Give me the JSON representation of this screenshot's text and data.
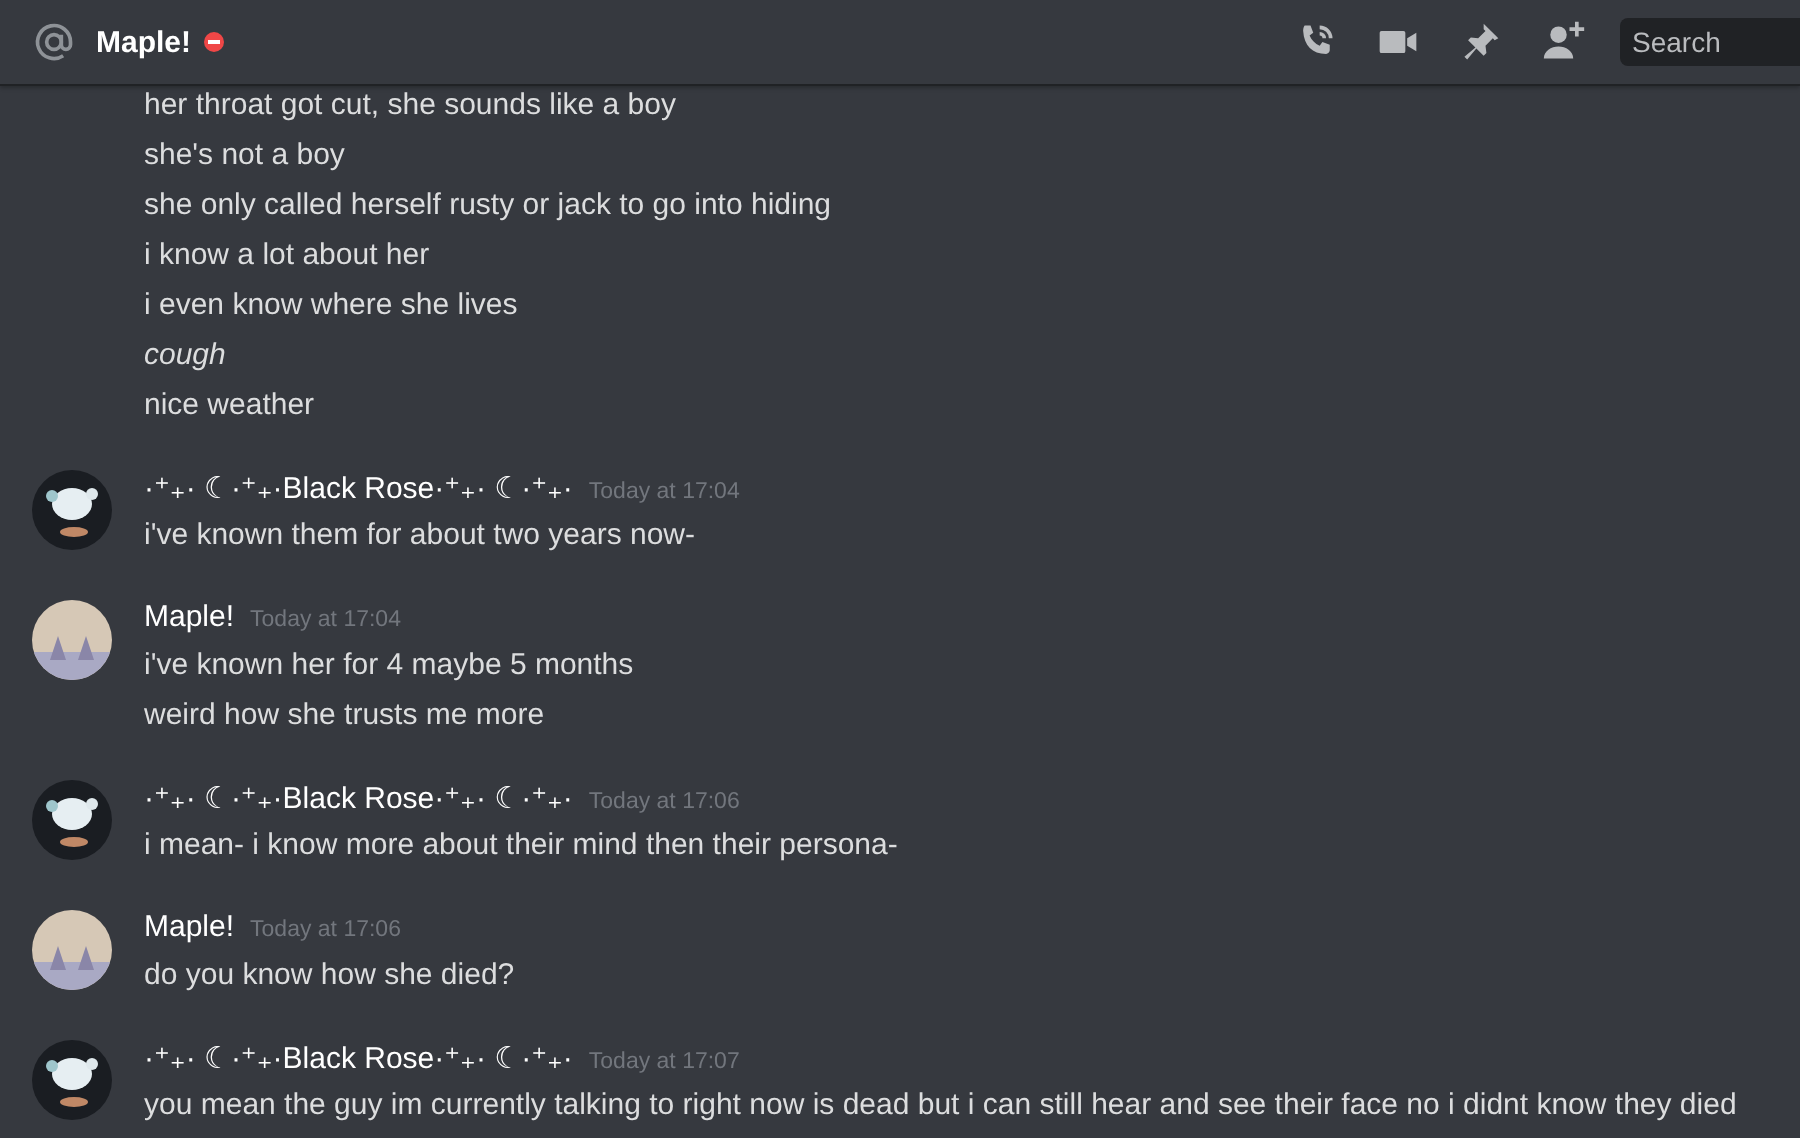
{
  "header": {
    "title": "Maple!",
    "status": {
      "kind": "dnd"
    },
    "search": {
      "placeholder": "Search"
    }
  },
  "messages": [
    {
      "lines": [
        {
          "text": "her throat got cut, she sounds like a boy",
          "italic": false
        },
        {
          "text": "she's not a boy",
          "italic": false
        },
        {
          "text": "she only called herself rusty or jack to go into hiding",
          "italic": false
        },
        {
          "text": "i know a lot about her",
          "italic": false
        },
        {
          "text": "i even know where she lives",
          "italic": false
        },
        {
          "text": "cough",
          "italic": true
        },
        {
          "text": "nice weather",
          "italic": false
        }
      ]
    },
    {
      "author": "·⁺₊· ☾·⁺₊·Black Rose·⁺₊· ☾·⁺₊·",
      "time": "Today at 17:04",
      "kind": "dark",
      "lines": [
        {
          "text": "i've known them for about two years now-",
          "italic": false
        }
      ]
    },
    {
      "author": "Maple!",
      "time": "Today at 17:04",
      "kind": "light",
      "lines": [
        {
          "text": "i've known her for 4 maybe 5 months",
          "italic": false
        },
        {
          "text": "weird how she trusts me more",
          "italic": false
        }
      ]
    },
    {
      "author": "·⁺₊· ☾·⁺₊·Black Rose·⁺₊· ☾·⁺₊·",
      "time": "Today at 17:06",
      "kind": "dark",
      "lines": [
        {
          "text": "i mean- i know more about their mind then their persona-",
          "italic": false
        }
      ]
    },
    {
      "author": "Maple!",
      "time": "Today at 17:06",
      "kind": "light",
      "lines": [
        {
          "text": "do you know how she died?",
          "italic": false
        }
      ]
    },
    {
      "author": "·⁺₊· ☾·⁺₊·Black Rose·⁺₊· ☾·⁺₊·",
      "time": "Today at 17:07",
      "kind": "dark",
      "lines": [
        {
          "text": "you mean the guy im currently talking to right now is dead but i can still hear and see their face no i didnt know they died",
          "italic": false
        }
      ]
    }
  ]
}
